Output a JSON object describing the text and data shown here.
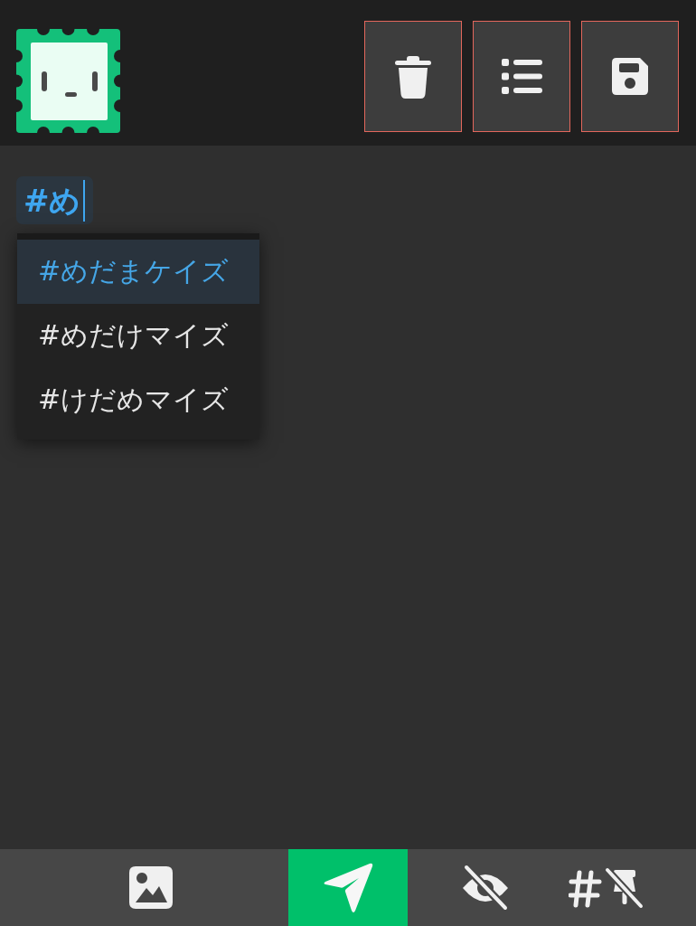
{
  "tag_input": {
    "value": "#め",
    "focused": true
  },
  "suggestions": [
    {
      "label": "#めだまケイズ",
      "selected": true
    },
    {
      "label": "#めだけマイズ",
      "selected": false
    },
    {
      "label": "#けだめマイズ",
      "selected": false
    }
  ]
}
